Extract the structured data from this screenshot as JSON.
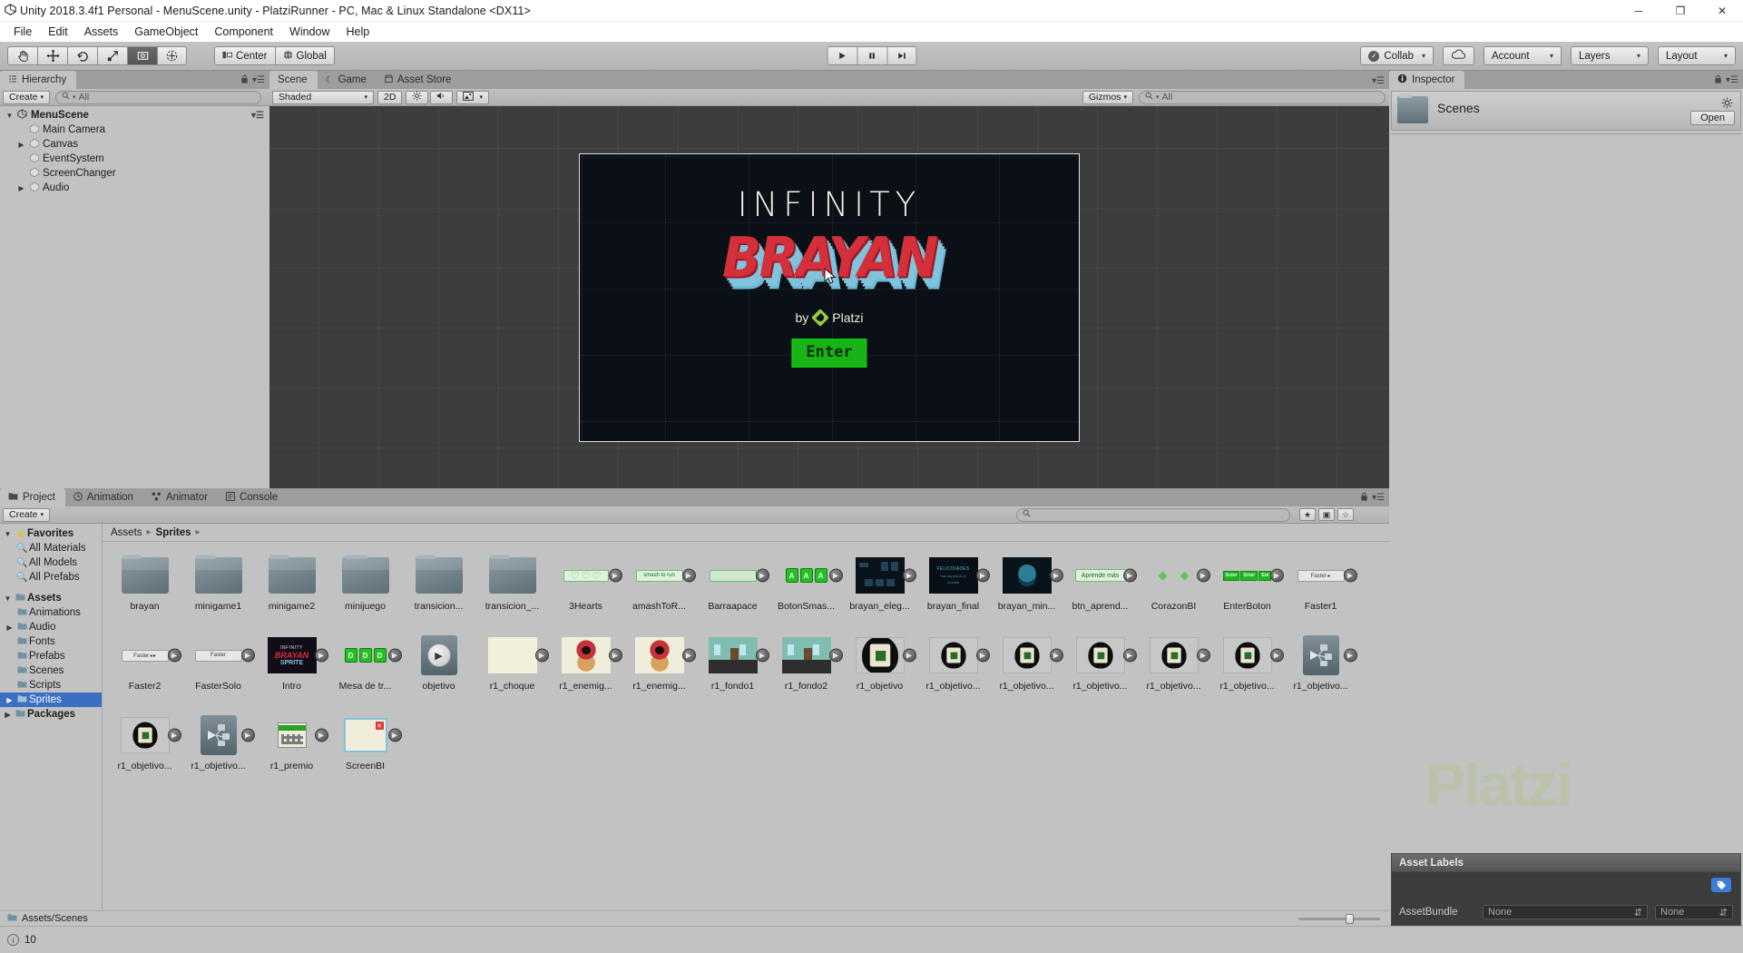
{
  "window": {
    "title": "Unity 2018.3.4f1 Personal - MenuScene.unity - PlatziRunner - PC, Mac & Linux Standalone <DX11>",
    "logo_icon": "unity-logo-icon",
    "minimize": "─",
    "maximize": "❐",
    "close": "✕"
  },
  "menu": {
    "items": [
      "File",
      "Edit",
      "Assets",
      "GameObject",
      "Component",
      "Window",
      "Help"
    ]
  },
  "toolbar": {
    "tools": [
      {
        "name": "hand-tool",
        "icon": "hand-icon",
        "active": false
      },
      {
        "name": "move-tool",
        "icon": "move-icon",
        "active": false
      },
      {
        "name": "rotate-tool",
        "icon": "rotate-icon",
        "active": false
      },
      {
        "name": "scale-tool",
        "icon": "scale-icon",
        "active": false
      },
      {
        "name": "rect-tool",
        "icon": "rect-icon",
        "active": true
      },
      {
        "name": "transform-tool",
        "icon": "transform-icon",
        "active": false
      }
    ],
    "pivot_label": "Center",
    "pivot_icon": "pivot-center-icon",
    "space_label": "Global",
    "space_icon": "globe-icon",
    "play": "▶",
    "pause": "❘❘",
    "step": "▶❘",
    "collab_label": "Collab",
    "collab_check": "✓",
    "cloud_icon": "cloud-icon",
    "account_label": "Account",
    "layers_label": "Layers",
    "layout_label": "Layout",
    "caret": "▼"
  },
  "hierarchy": {
    "tab_label": "Hierarchy",
    "tab_icon": "hierarchy-icon",
    "create_label": "Create",
    "search_placeholder": "All",
    "search_icon": "search-icon",
    "lock_icon": "lock-icon",
    "menu_icon": "panel-menu-icon",
    "scene_name": "MenuScene",
    "items": [
      {
        "label": "Main Camera",
        "expandable": false,
        "depth": 1
      },
      {
        "label": "Canvas",
        "expandable": true,
        "depth": 1
      },
      {
        "label": "EventSystem",
        "expandable": false,
        "depth": 1
      },
      {
        "label": "ScreenChanger",
        "expandable": false,
        "depth": 1
      },
      {
        "label": "Audio",
        "expandable": true,
        "depth": 1
      }
    ]
  },
  "scene_view": {
    "tabs": [
      {
        "label": "Scene",
        "icon": "scene-icon",
        "active": true
      },
      {
        "label": "Game",
        "icon": "game-icon",
        "active": false
      },
      {
        "label": "Asset Store",
        "icon": "store-icon",
        "active": false
      }
    ],
    "shading_label": "Shaded",
    "mode_2d": "2D",
    "lighting_icon": "sun-icon",
    "audio_icon": "speaker-icon",
    "effects_icon": "image-icon",
    "gizmos_label": "Gizmos",
    "search_placeholder": "All",
    "menu_icon": "panel-menu-icon",
    "game": {
      "title": "INFINITY",
      "logo": "BRAYAN",
      "by_text": "by",
      "brand": "Platzi",
      "brand_icon": "platzi-logo-icon",
      "enter_label": "Enter",
      "cursor_icon": "cursor-arrow-icon"
    }
  },
  "inspector": {
    "tab_label": "Inspector",
    "tab_icon": "info-icon",
    "lock_icon": "lock-icon",
    "menu_icon": "panel-menu-icon",
    "asset_name": "Scenes",
    "asset_icon": "folder-icon",
    "gear_icon": "gear-icon",
    "open_label": "Open",
    "watermark": "Platzi",
    "asset_labels": {
      "header": "Asset Labels",
      "tag_icon": "tag-icon",
      "bundle_label": "AssetBundle",
      "bundle_value": "None",
      "variant_value": "None",
      "dropdown_icon": "updown-arrows-icon"
    }
  },
  "project": {
    "tabs": [
      {
        "label": "Project",
        "icon": "folder-icon",
        "active": true
      },
      {
        "label": "Animation",
        "icon": "clock-icon",
        "active": false
      },
      {
        "label": "Animator",
        "icon": "animator-icon",
        "active": false
      },
      {
        "label": "Console",
        "icon": "console-icon",
        "active": false
      }
    ],
    "create_label": "Create",
    "search_placeholder": "",
    "search_icon": "search-icon",
    "filter_icons": [
      "favorite-filter-icon",
      "type-filter-icon",
      "label-filter-icon"
    ],
    "lock_icon": "lock-icon",
    "menu_icon": "panel-menu-icon",
    "breadcrumb": [
      "Assets",
      "Sprites"
    ],
    "breadcrumb_sep": "›",
    "tree": [
      {
        "label": "Favorites",
        "icon": "star-icon",
        "depth": 0,
        "bold": true,
        "arrow": "▼",
        "selected": false
      },
      {
        "label": "All Materials",
        "icon": "search-yellow-icon",
        "depth": 1,
        "bold": false,
        "arrow": "",
        "selected": false
      },
      {
        "label": "All Models",
        "icon": "search-yellow-icon",
        "depth": 1,
        "bold": false,
        "arrow": "",
        "selected": false
      },
      {
        "label": "All Prefabs",
        "icon": "search-yellow-icon",
        "depth": 1,
        "bold": false,
        "arrow": "",
        "selected": false
      },
      {
        "label": "Assets",
        "icon": "folder-icon",
        "depth": 0,
        "bold": true,
        "arrow": "▼",
        "selected": false
      },
      {
        "label": "Animations",
        "icon": "folder-icon",
        "depth": 1,
        "bold": false,
        "arrow": "",
        "selected": false
      },
      {
        "label": "Audio",
        "icon": "folder-icon",
        "depth": 1,
        "bold": false,
        "arrow": "▶",
        "selected": false
      },
      {
        "label": "Fonts",
        "icon": "folder-icon",
        "depth": 1,
        "bold": false,
        "arrow": "",
        "selected": false
      },
      {
        "label": "Prefabs",
        "icon": "folder-icon",
        "depth": 1,
        "bold": false,
        "arrow": "",
        "selected": false
      },
      {
        "label": "Scenes",
        "icon": "folder-icon",
        "depth": 1,
        "bold": false,
        "arrow": "",
        "selected": false
      },
      {
        "label": "Scripts",
        "icon": "folder-icon",
        "depth": 1,
        "bold": false,
        "arrow": "",
        "selected": false
      },
      {
        "label": "Sprites",
        "icon": "folder-icon",
        "depth": 1,
        "bold": false,
        "arrow": "▶",
        "selected": true
      },
      {
        "label": "Packages",
        "icon": "folder-icon",
        "depth": 0,
        "bold": true,
        "arrow": "▶",
        "selected": false
      }
    ],
    "assets": [
      {
        "label": "brayan",
        "kind": "folder"
      },
      {
        "label": "minigame1",
        "kind": "folder"
      },
      {
        "label": "minigame2",
        "kind": "folder"
      },
      {
        "label": "minijuego",
        "kind": "folder-open"
      },
      {
        "label": "transicion...",
        "kind": "folder"
      },
      {
        "label": "transicion_...",
        "kind": "folder"
      },
      {
        "label": "3Hearts",
        "kind": "hearts"
      },
      {
        "label": "amashToR...",
        "kind": "pill-green",
        "text": "smash to run"
      },
      {
        "label": "Barraapace",
        "kind": "pill-bar"
      },
      {
        "label": "BotonSmas...",
        "kind": "boton-group"
      },
      {
        "label": "brayan_eleg...",
        "kind": "scene-dark-a"
      },
      {
        "label": "brayan_final",
        "kind": "scene-dark-b"
      },
      {
        "label": "brayan_min...",
        "kind": "scene-face"
      },
      {
        "label": "btn_aprend...",
        "kind": "pill-outline",
        "text": "Aprende más"
      },
      {
        "label": "CorazonBI",
        "kind": "hearts-mixed"
      },
      {
        "label": "EnterBoton",
        "kind": "enter-group"
      },
      {
        "label": "Faster1",
        "kind": "pill-grey",
        "text": "Faster ▸"
      },
      {
        "label": "Faster2",
        "kind": "pill-grey",
        "text": "Faster ▸▸"
      },
      {
        "label": "FasterSolo",
        "kind": "pill-grey",
        "text": "Faster"
      },
      {
        "label": "Intro",
        "kind": "intro"
      },
      {
        "label": "Mesa de tr...",
        "kind": "boton-group-d"
      },
      {
        "label": "objetivo",
        "kind": "objetivo"
      },
      {
        "label": "r1_choque",
        "kind": "choque"
      },
      {
        "label": "r1_enemig...",
        "kind": "enemy"
      },
      {
        "label": "r1_enemig...",
        "kind": "enemy"
      },
      {
        "label": "r1_fondo1",
        "kind": "room"
      },
      {
        "label": "r1_fondo2",
        "kind": "room"
      },
      {
        "label": "r1_objetivo",
        "kind": "objective-lg"
      },
      {
        "label": "r1_objetivo...",
        "kind": "objective"
      },
      {
        "label": "r1_objetivo...",
        "kind": "objective"
      },
      {
        "label": "r1_objetivo...",
        "kind": "objective"
      },
      {
        "label": "r1_objetivo...",
        "kind": "objective"
      },
      {
        "label": "r1_objetivo...",
        "kind": "objective"
      },
      {
        "label": "r1_objetivo...",
        "kind": "anim"
      },
      {
        "label": "r1_objetivo...",
        "kind": "objective"
      },
      {
        "label": "r1_objetivo...",
        "kind": "anim"
      },
      {
        "label": "r1_premio",
        "kind": "premio"
      },
      {
        "label": "ScreenBI",
        "kind": "screenbi"
      }
    ],
    "footer_path": "Assets/Scenes",
    "footer_icon": "folder-icon"
  },
  "statusbar": {
    "icon": "info-circle-icon",
    "text": "10"
  }
}
